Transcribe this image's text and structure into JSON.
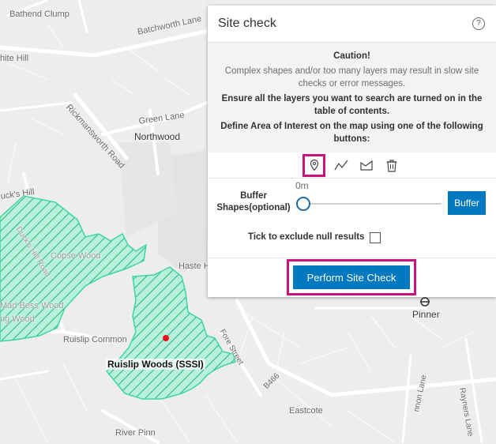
{
  "map": {
    "labels": {
      "bathend_clump": "Bathend Clump",
      "white_hill": "hite Hill",
      "batchworth_lane": "Batchworth Lane",
      "rickmansworth_road": "Rickmansworth Road",
      "green_lane": "Green Lane",
      "northwood": "Northwood",
      "ducks_hill": "uck's Hill",
      "ducks_hill_road": "Duck's Hill Road",
      "copse_wood": "Copse Wood",
      "mad_bess_wood": "Mad Bess Wood",
      "ng_wood": "ng Wood",
      "haste_hill": "Haste Hi",
      "ruislip_common": "Ruislip Common",
      "ruislip_woods": "Ruislip Woods (SSSI)",
      "fore_street": "Fore Street",
      "b466": "B466",
      "pinner": "Pinner",
      "eastcote": "Eastcote",
      "river_pinn": "River Pinn",
      "rayners_lane": "Rayners Lane",
      "cannon_lane": "nnon Lane"
    },
    "colors": {
      "sssi_fill": "#3ed6a0",
      "sssi_hatch": "#1fb87e",
      "marker": "#e8141a"
    }
  },
  "panel": {
    "title": "Site check",
    "help_icon": "question-circle-icon",
    "caution_title": "Caution!",
    "caution_text": "Complex shapes and/or too many layers may result in slow site checks or error messages.",
    "ensure_text": "Ensure all the layers you want to search are turned on in the table of contents.",
    "define_text": "Define Area of Interest on the map using one of the following buttons:",
    "tools": [
      {
        "name": "point-tool",
        "icon": "map-pin-icon",
        "selected": true
      },
      {
        "name": "polyline-tool",
        "icon": "polyline-icon",
        "selected": false
      },
      {
        "name": "polygon-tool",
        "icon": "polygon-icon",
        "selected": false
      },
      {
        "name": "delete-tool",
        "icon": "trash-icon",
        "selected": false
      }
    ],
    "buffer_label": "Buffer Shapes(optional)",
    "buffer_value": "0m",
    "buffer_button": "Buffer",
    "exclude_label": "Tick to exclude null results",
    "exclude_checked": false,
    "perform_button": "Perform Site Check",
    "colors": {
      "accent": "#0079c1",
      "highlight": "#c8137a"
    }
  }
}
